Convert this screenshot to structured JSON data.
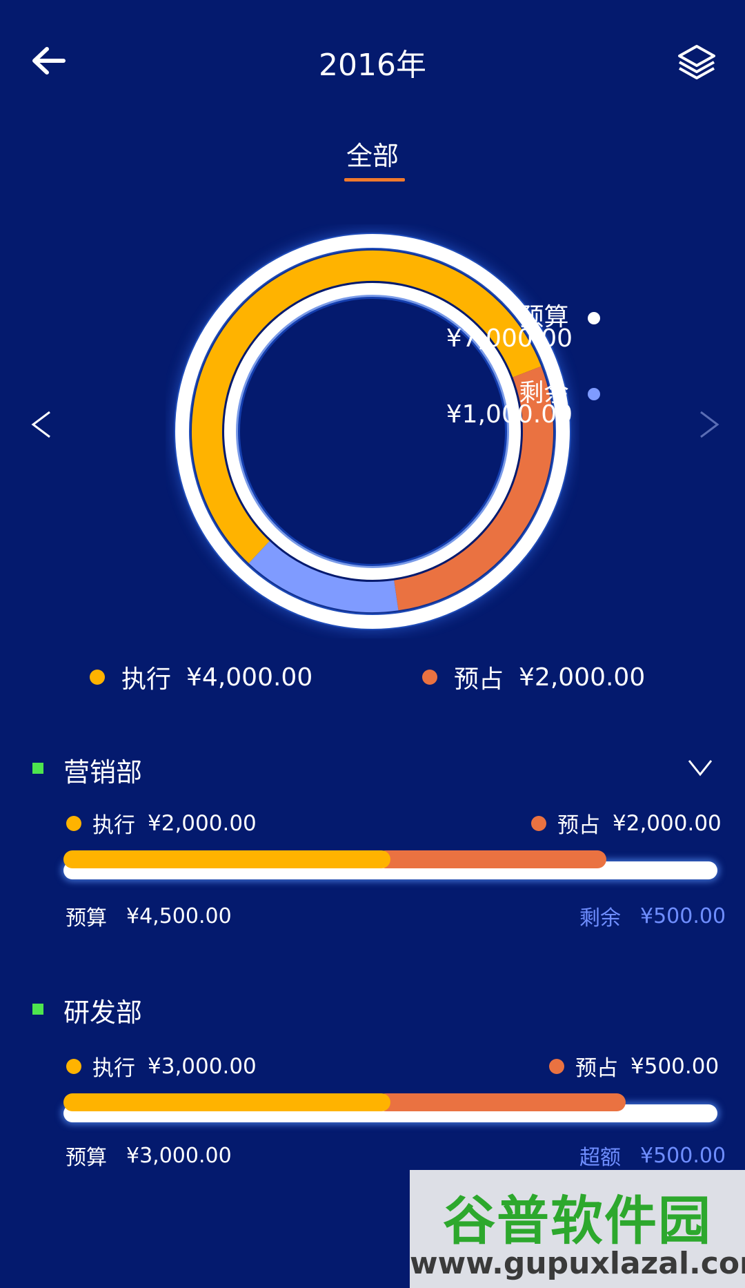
{
  "header": {
    "title": "2016年"
  },
  "tabs": [
    {
      "label": "全部",
      "active": true
    }
  ],
  "summary": {
    "budget_label": "预算",
    "budget_value": "¥7,000.00",
    "remaining_label": "剩余",
    "remaining_value": "¥1,000.00",
    "executed_label": "执行",
    "executed_value": "¥4,000.00",
    "reserved_label": "预占",
    "reserved_value": "¥2,000.00"
  },
  "chart_data": {
    "type": "pie",
    "categories": [
      "执行",
      "预占",
      "剩余"
    ],
    "values": [
      4000,
      2000,
      1000
    ],
    "colors": [
      "#ffb300",
      "#ea7241",
      "#7f9bff"
    ]
  },
  "departments": [
    {
      "name": "营销部",
      "executed_label": "执行",
      "executed_value": "¥2,000.00",
      "reserved_label": "预占",
      "reserved_value": "¥2,000.00",
      "budget_label": "预算",
      "budget_value": "¥4,500.00",
      "status_label": "剩余",
      "status_value": "¥500.00",
      "executed_fraction": 0.5,
      "reserved_fraction": 0.33,
      "expanded": false
    },
    {
      "name": "研发部",
      "executed_label": "执行",
      "executed_value": "¥3,000.00",
      "reserved_label": "预占",
      "reserved_value": "¥500.00",
      "budget_label": "预算",
      "budget_value": "¥3,000.00",
      "status_label": "超额",
      "status_value": "¥500.00",
      "executed_fraction": 0.5,
      "reserved_fraction": 0.36,
      "expanded": false
    }
  ],
  "colors": {
    "background": "#041a6e",
    "executed": "#ffb300",
    "reserved": "#ea7241",
    "remaining": "#7f9bff",
    "marker": "#4ee54e"
  },
  "watermark": {
    "text": "谷普软件园",
    "url": "www.gupuxlazal.com"
  }
}
